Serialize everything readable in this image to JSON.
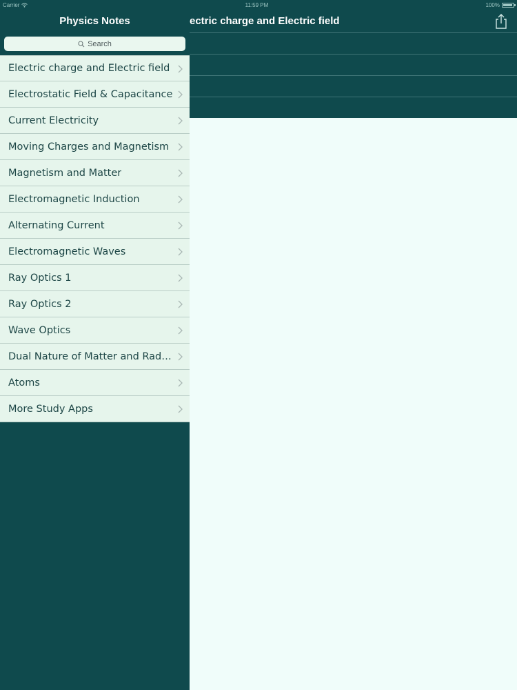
{
  "status_bar": {
    "carrier": "Carrier",
    "time": "11:59 PM",
    "battery": "100%"
  },
  "sidebar": {
    "title": "Physics Notes",
    "search_placeholder": "Search",
    "items": [
      {
        "label": "Electric charge and Electric field"
      },
      {
        "label": "Electrostatic Field & Capacitance"
      },
      {
        "label": "Current Electricity"
      },
      {
        "label": "Moving Charges and Magnetism"
      },
      {
        "label": "Magnetism and Matter"
      },
      {
        "label": "Electromagnetic Induction"
      },
      {
        "label": "Alternating Current"
      },
      {
        "label": "Electromagnetic Waves"
      },
      {
        "label": "Ray Optics 1"
      },
      {
        "label": "Ray Optics 2"
      },
      {
        "label": "Wave Optics"
      },
      {
        "label": "Dual Nature of Matter and Radiat…"
      },
      {
        "label": "Atoms"
      },
      {
        "label": "More Study Apps"
      }
    ]
  },
  "detail": {
    "title": "ectric charge and Electric field"
  },
  "colors": {
    "nav_background": "#0f4a4d",
    "list_background": "#e6f5ec",
    "content_background": "#f0fdfa",
    "list_text": "#1d4646"
  },
  "icons": {
    "search": "search-icon",
    "share": "share-icon",
    "chevron": "chevron-right-icon",
    "wifi": "wifi-icon",
    "battery": "battery-icon"
  }
}
